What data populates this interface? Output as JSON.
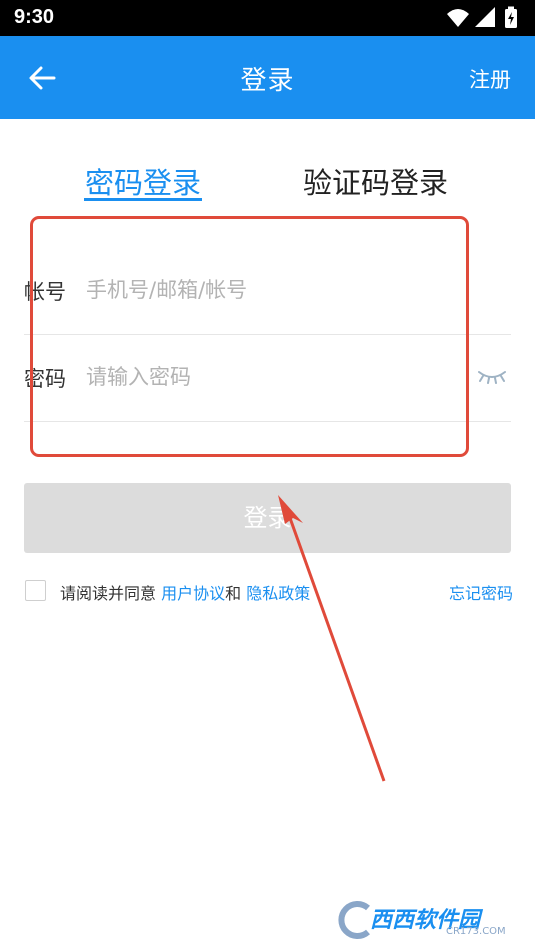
{
  "status_bar": {
    "time": "9:30",
    "icons": [
      "wifi-icon",
      "signal-icon",
      "battery-charging-icon"
    ]
  },
  "header": {
    "back_icon": "arrow-left-icon",
    "title": "登录",
    "register_label": "注册",
    "background_color": "#1a8ff0"
  },
  "tabs": [
    {
      "label": "密码登录",
      "active": true
    },
    {
      "label": "验证码登录",
      "active": false
    }
  ],
  "form": {
    "account": {
      "label": "帐号",
      "placeholder": "手机号/邮箱/帐号",
      "value": ""
    },
    "password": {
      "label": "密码",
      "placeholder": "请输入密码",
      "value": "",
      "toggle_icon": "eye-closed-icon"
    }
  },
  "login_button": {
    "label": "登录",
    "enabled": false
  },
  "agreement": {
    "checked": false,
    "prefix": "请阅读并同意 ",
    "user_agreement": "用户协议",
    "connector": "和 ",
    "privacy_policy": "隐私政策"
  },
  "forgot_password": "忘记密码",
  "annotation": {
    "box_color": "#e04a3a",
    "arrow_color": "#e04a3a"
  },
  "watermark": {
    "text": "西西软件园",
    "domain": "CR173.COM"
  }
}
